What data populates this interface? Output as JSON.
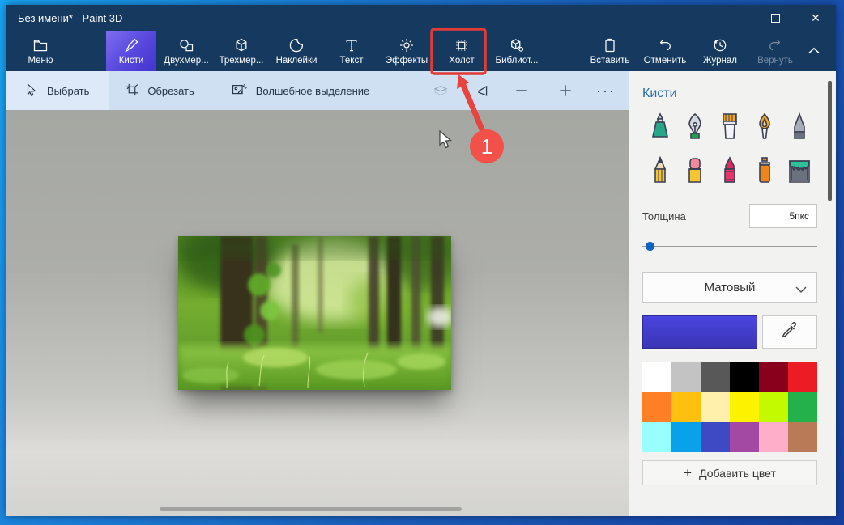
{
  "window": {
    "title": "Без имени* - Paint 3D",
    "controls": {
      "minimize": "–",
      "close": "✕"
    }
  },
  "ribbon": {
    "items": [
      {
        "label": "Меню",
        "icon": "menu-folder-icon"
      },
      {
        "label": "Кисти",
        "icon": "brush-icon",
        "selected": true
      },
      {
        "label": "Двухмер...",
        "icon": "2d-shapes-icon"
      },
      {
        "label": "Трехмер...",
        "icon": "3d-shapes-icon"
      },
      {
        "label": "Наклейки",
        "icon": "sticker-icon"
      },
      {
        "label": "Текст",
        "icon": "text-icon"
      },
      {
        "label": "Эффекты",
        "icon": "effects-icon"
      },
      {
        "label": "Холст",
        "icon": "canvas-icon",
        "annotated": true
      },
      {
        "label": "Библиот...",
        "icon": "library-icon"
      },
      {
        "label": "Вставить",
        "icon": "paste-icon"
      },
      {
        "label": "Отменить",
        "icon": "undo-icon"
      },
      {
        "label": "Журнал",
        "icon": "history-icon"
      },
      {
        "label": "Вернуть",
        "icon": "redo-icon",
        "disabled": true
      }
    ]
  },
  "subtoolbar": {
    "select_label": "Выбрать",
    "crop_label": "Обрезать",
    "magic_select_label": "Волшебное выделение",
    "zoom_out_glyph": "—",
    "zoom_in_glyph": "+",
    "more_glyph": "···"
  },
  "panel": {
    "title": "Кисти",
    "brushes": [
      "marker",
      "calligraphy-pen",
      "flat-brush",
      "oil-brush",
      "watercolor-brush",
      "pencil",
      "eraser",
      "crayon",
      "spray-can",
      "fill-bucket"
    ],
    "thickness": {
      "label": "Толщина",
      "value": "5пкс"
    },
    "finish": {
      "value": "Матовый"
    },
    "current_color": "#423cc8",
    "palette_colors": [
      "#ffffff",
      "#c3c3c3",
      "#585858",
      "#000000",
      "#88001b",
      "#ec1c24",
      "#ff7f27",
      "#fec00f",
      "#fff1ac",
      "#fdf300",
      "#c3fa00",
      "#24b14c",
      "#99feff",
      "#09a1e9",
      "#3e49c4",
      "#a349a4",
      "#feaec9",
      "#b97a57"
    ],
    "add_color_label": "Добавить цвет"
  },
  "annotation": {
    "step_number": "1",
    "accent_color": "#e8433e"
  },
  "colors": {
    "titlebar": "#16395f",
    "selected_tab": "#5747dd",
    "subtoolbar": "#cfe0f2"
  }
}
